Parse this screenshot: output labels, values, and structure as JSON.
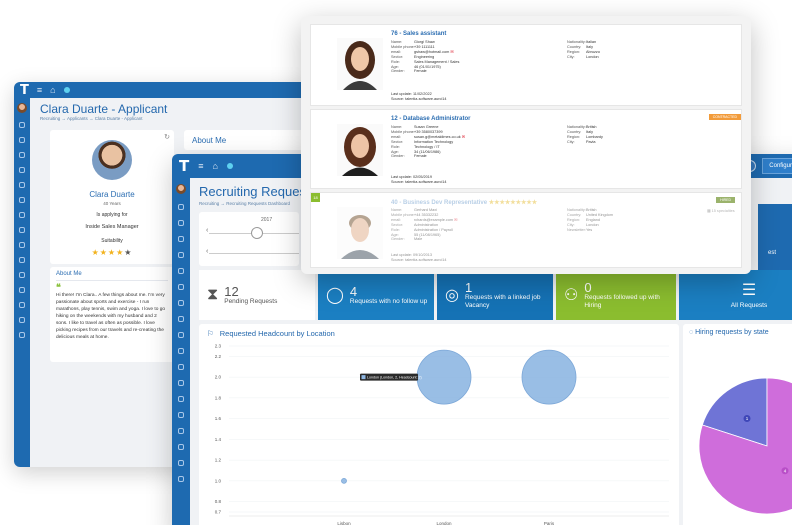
{
  "applicant": {
    "app_title": "Clara Duarte - Applicant",
    "breadcrumb": "Recruiting → Applicants → Clara Duarte - Applicant",
    "name": "Clara Duarte",
    "age": "40 Years",
    "applying_label": "Is applying for",
    "position": "Inside Sales Manager",
    "suitability_label": "Suitability",
    "stars_filled": 4,
    "stars_total": 5,
    "about_heading": "About Me",
    "about_text": "Hi there! I'm Clara.. A few things about me. I'm very passionate about sports and exercise - I run marathons, play tennis, swim and yoga. I love to go hiking on the weekends with my husband and 2 sons. I like to travel as often as possible. I love picking recipes from our travels and re-creating the delicious meals at home.",
    "panel_heading": "About Me"
  },
  "dashboard": {
    "title": "Recruiting Requests D",
    "breadcrumb": "Recruiting → Recruiting Requests Dashboard",
    "timeline_year": "2017",
    "config_label": "Configuration",
    "side_panel_text": "est",
    "tiles": [
      {
        "num": "12",
        "label": "Pending Requests"
      },
      {
        "num": "4",
        "label": "Requests with no follow up"
      },
      {
        "num": "1",
        "label": "Requests with a linked job Vacancy"
      },
      {
        "num": "0",
        "label": "Requests followed up with Hiring"
      },
      {
        "num": "",
        "label": "All Requests"
      }
    ],
    "pie_title": "Hiring requests by state"
  },
  "chart_data": [
    {
      "type": "scatter",
      "title": "Requested Headcount by Location",
      "categories": [
        "Lisbon",
        "London",
        "Paris"
      ],
      "y_ticks": [
        "2.3",
        "2.2",
        "2.0",
        "1.8",
        "1.6",
        "1.4",
        "1.2",
        "1.0",
        "0.8",
        "0.7"
      ],
      "ylim": [
        0.7,
        2.3
      ],
      "series": [
        {
          "values": [
            1,
            2,
            2
          ]
        }
      ],
      "tooltip": "London (London, 2, Headcount: 2)"
    },
    {
      "type": "pie",
      "title": "Hiring requests by state",
      "values": [
        4,
        1
      ],
      "labels": [
        "4",
        "1"
      ],
      "colors": [
        "#cf6ddb",
        "#6f74d6"
      ]
    }
  ],
  "candidates": [
    {
      "title": "76 - Sales assistant",
      "fields": [
        [
          "Name:",
          "Giorgi Shaw"
        ],
        [
          "Mobile phone:",
          "+39 1111111"
        ],
        [
          "email:",
          "gshaw@hotmail.com"
        ],
        [
          "Sector:",
          "Engineering"
        ],
        [
          "Role:",
          "Sales Management / Sales"
        ],
        [
          "Age:",
          "46 (01/01/1975)"
        ],
        [
          "Gender:",
          "Female"
        ]
      ],
      "right": [
        [
          "Nationality:",
          "Italian"
        ],
        [
          "Country:",
          "Italy"
        ],
        [
          "Region:",
          "Abruzzo"
        ],
        [
          "City:",
          "London"
        ]
      ],
      "last_update": "Last update: 11/02/2022",
      "source": "Source: talentia-software.aurci14",
      "badge": ""
    },
    {
      "title": "12 - Database Administrator",
      "fields": [
        [
          "Name:",
          "Susan Greene"
        ],
        [
          "Mobile phone:",
          "+39 3580037399"
        ],
        [
          "email:",
          "susan.g@metaldimes.co.uk"
        ],
        [
          "Sector:",
          "Information Technology"
        ],
        [
          "Role:",
          "Technology / IT"
        ],
        [
          "Age:",
          "34 (11/06/1986)"
        ],
        [
          "Gender:",
          "Female"
        ]
      ],
      "right": [
        [
          "Nationality:",
          "British"
        ],
        [
          "Country:",
          "Italy"
        ],
        [
          "Region:",
          "Lombardy"
        ],
        [
          "City:",
          "Pavia"
        ]
      ],
      "last_update": "Last update: 02/05/2019",
      "source": "Source: talentia-software.aurci14",
      "badge": "CONTRACTED"
    },
    {
      "num": "18",
      "title": "40 - Business Dev Representative",
      "fields": [
        [
          "Name:",
          "Gerhard Maxi"
        ],
        [
          "Mobile phone:",
          "+44 35332232"
        ],
        [
          "email:",
          "rchards@example.com"
        ],
        [
          "Sector:",
          "Administration"
        ],
        [
          "Role:",
          "Administration / Payroll"
        ],
        [
          "Age:",
          "55 (11/08/1965)"
        ],
        [
          "Gender:",
          "Male"
        ]
      ],
      "right": [
        [
          "Nationality:",
          "British"
        ],
        [
          "Country:",
          "United Kingdom"
        ],
        [
          "Region:",
          "England"
        ],
        [
          "City:",
          "London"
        ],
        [
          "Newsletter:",
          "Yes"
        ]
      ],
      "last_update": "Last update: 09/10/2013",
      "source": "Source: talentia-software.aurci14",
      "badge": "HIRED",
      "specialties": "15 specialties"
    }
  ]
}
